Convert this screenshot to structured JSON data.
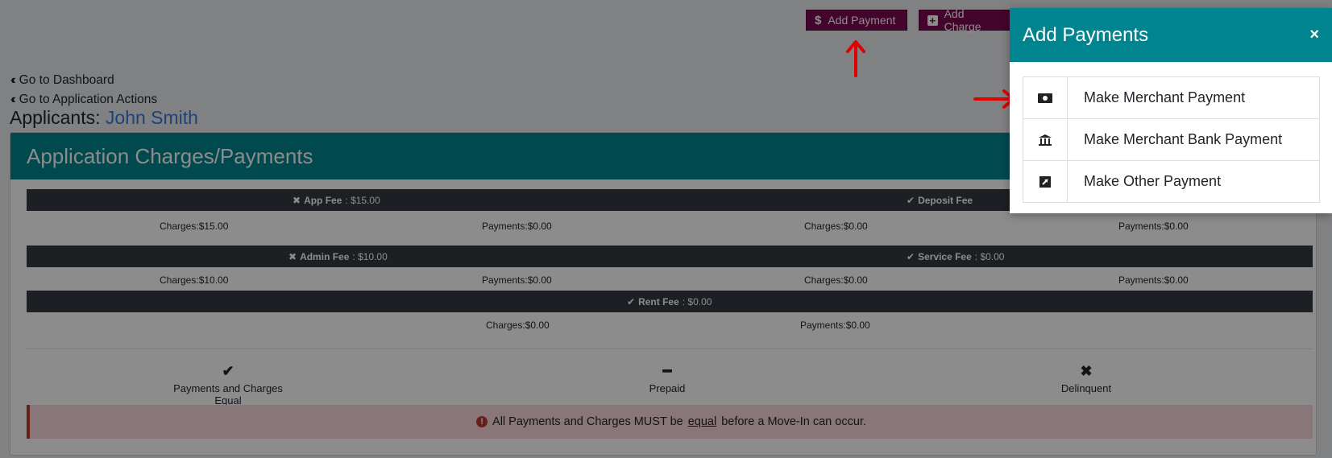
{
  "header_buttons": {
    "add_payment": {
      "icon": "dollar-icon",
      "glyph": "$",
      "label": "Add Payment"
    },
    "add_charge": {
      "icon": "plus-square-icon",
      "glyph": "+",
      "label": "Add Charge"
    }
  },
  "nav": {
    "dashboard": "Go to Dashboard",
    "application_actions": "Go to Application Actions"
  },
  "applicants": {
    "label": "Applicants:",
    "name": "John Smith"
  },
  "card": {
    "title": "Application Charges/Payments",
    "fees": [
      {
        "status": "x",
        "name": "App Fee",
        "amount": ": $15.00",
        "charges": "$15.00",
        "payments": "$0.00"
      },
      {
        "status": "check",
        "name": "Deposit Fee",
        "amount": "",
        "charges": "$0.00",
        "payments": "$0.00"
      },
      {
        "status": "x",
        "name": "Admin Fee",
        "amount": ": $10.00",
        "charges": "$10.00",
        "payments": "$0.00"
      },
      {
        "status": "check",
        "name": "Service Fee",
        "amount": ": $0.00",
        "charges": "$0.00",
        "payments": "$0.00"
      },
      {
        "status": "check",
        "name": "Rent Fee",
        "amount": ": $0.00",
        "charges": "$0.00",
        "payments": "$0.00"
      }
    ],
    "charges_label": "Charges:",
    "payments_label": "Payments:",
    "legend": [
      {
        "icon": "check-icon",
        "glyph": "✔",
        "label": "Payments and Charges Equal"
      },
      {
        "icon": "minus-icon",
        "glyph": "━",
        "label": "Prepaid"
      },
      {
        "icon": "x-icon",
        "glyph": "✖",
        "label": "Delinquent"
      }
    ],
    "alert": {
      "before": "All Payments and Charges MUST be",
      "emph": "equal",
      "after": "before a Move-In can occur."
    }
  },
  "modal": {
    "title": "Add Payments",
    "close": "×",
    "options": [
      {
        "icon": "money-bill-icon",
        "label": "Make Merchant Payment"
      },
      {
        "icon": "bank-icon",
        "label": "Make Merchant Bank Payment"
      },
      {
        "icon": "external-link-icon",
        "label": "Make Other Payment"
      }
    ]
  },
  "colors": {
    "teal": "#008590",
    "maroon": "#7b0a4f",
    "dark_bar": "#343a40",
    "alert_bg": "#f8d7da",
    "arrow": "#e00000"
  }
}
